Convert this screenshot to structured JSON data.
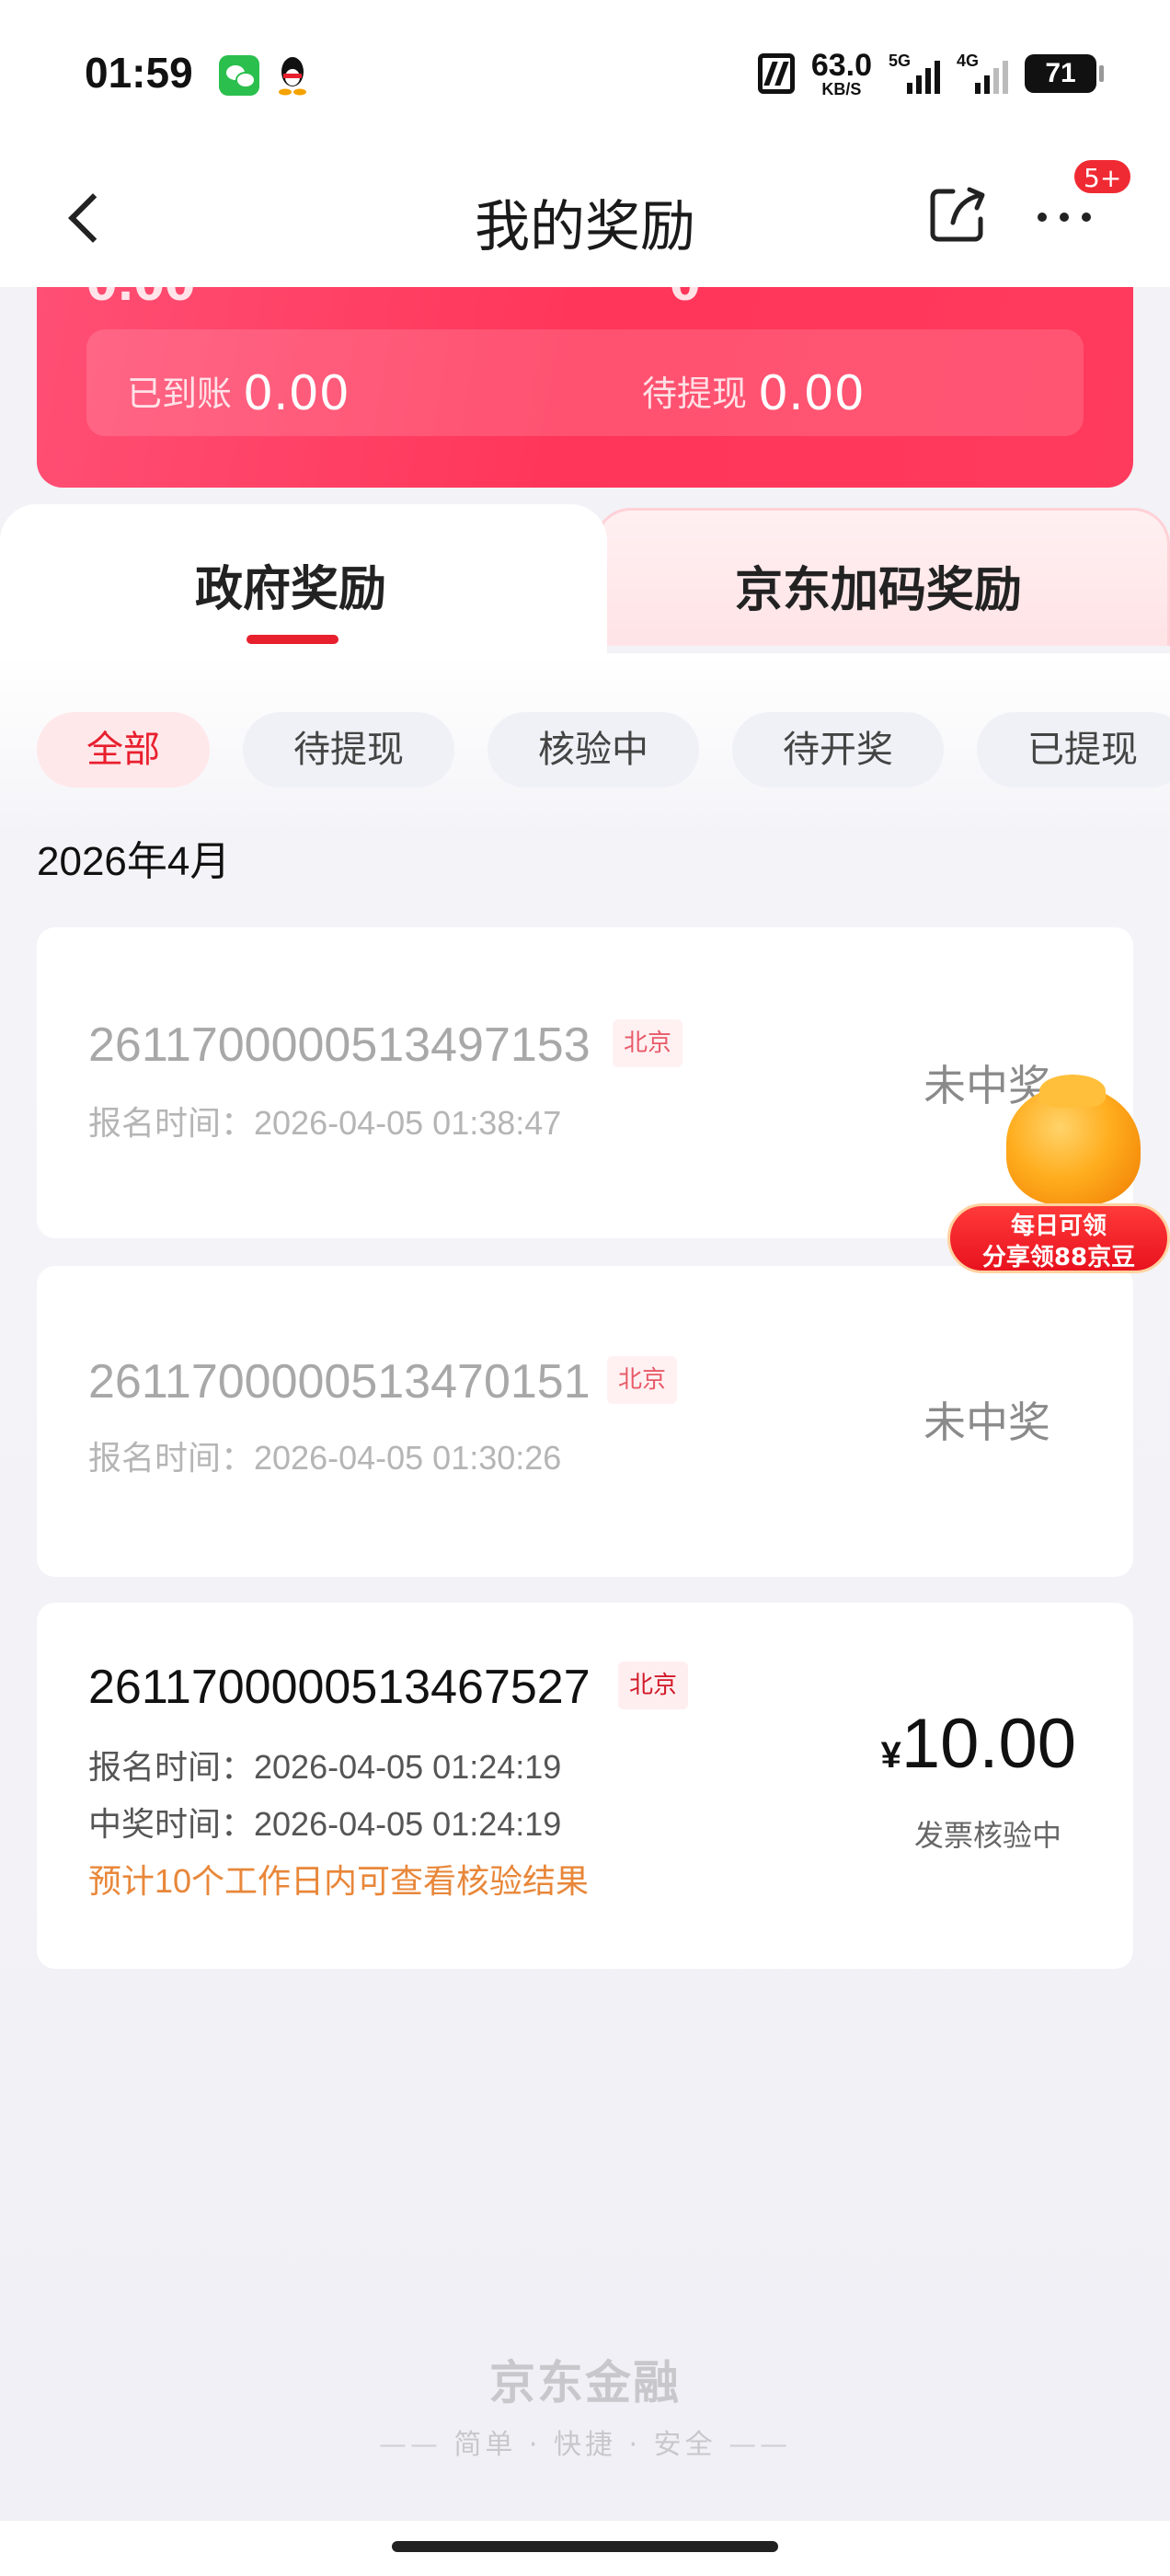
{
  "status_bar": {
    "time": "01:59",
    "net_speed_value": "63.0",
    "net_speed_unit": "KB/S",
    "sim1_label": "5G",
    "sim2_label": "4G",
    "battery": "71"
  },
  "header": {
    "title": "我的奖励",
    "badge": "5+"
  },
  "summary": {
    "received_label": "已到账",
    "received_value": "0.00",
    "pending_label": "待提现",
    "pending_value": "0.00"
  },
  "tabs": {
    "active_label": "政府奖励",
    "other_label": "京东加码奖励"
  },
  "filters": [
    "全部",
    "待提现",
    "核验中",
    "待开奖",
    "已提现"
  ],
  "month": "2026年4月",
  "records": [
    {
      "order_no": "2611700000513497153",
      "region": "北京",
      "signup_label": "报名时间：",
      "signup_time": "2026-04-05 01:38:47",
      "result": "未中奖"
    },
    {
      "order_no": "2611700000513470151",
      "region": "北京",
      "signup_label": "报名时间：",
      "signup_time": "2026-04-05 01:30:26",
      "result": "未中奖"
    },
    {
      "order_no": "2611700000513467527",
      "region": "北京",
      "signup_label": "报名时间：",
      "signup_time": "2026-04-05 01:24:19",
      "win_label": "中奖时间：",
      "win_time": "2026-04-05 01:24:19",
      "note": "预计10个工作日内可查看核验结果",
      "currency": "¥",
      "amount": "10.00",
      "status": "发票核验中"
    }
  ],
  "promo": {
    "line1": "每日可领",
    "line2": "分享领88京豆"
  },
  "footer": {
    "brand": "京东金融",
    "slogan": "简单 · 快捷 · 安全"
  },
  "colors": {
    "accent": "#e8202e",
    "card_red": "#ff3b5d",
    "note_orange": "#e8873a"
  }
}
